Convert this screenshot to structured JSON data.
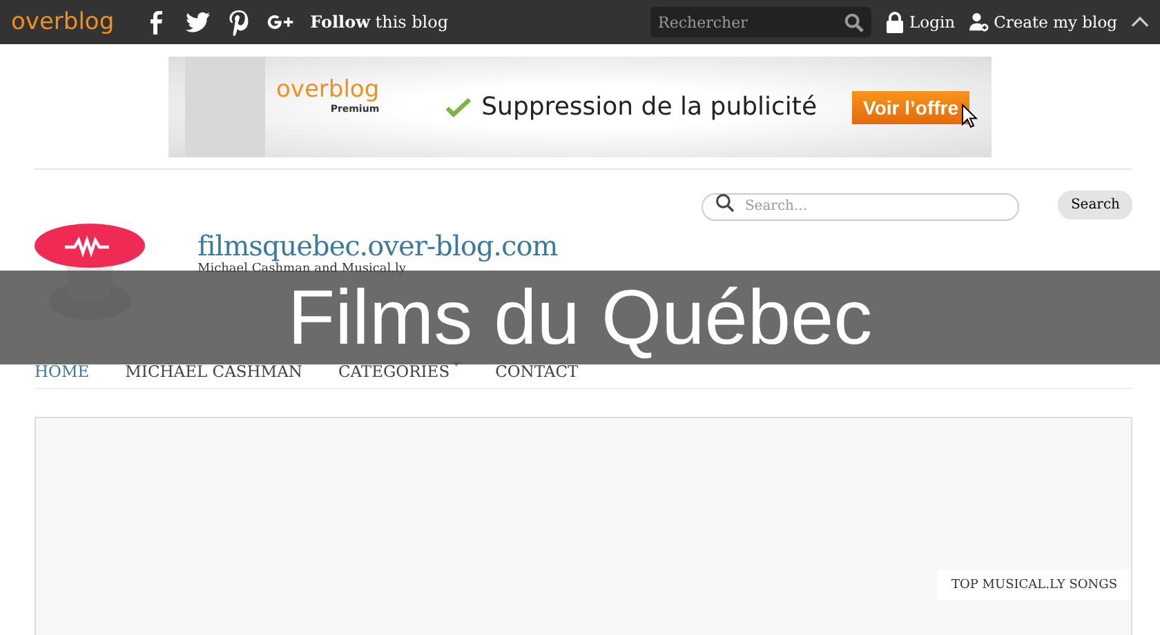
{
  "topbar": {
    "logo": "overblog",
    "follow_bold": "Follow",
    "follow_rest": "this blog",
    "search": {
      "placeholder": "Rechercher"
    },
    "login": "Login",
    "create": "Create my blog"
  },
  "ad": {
    "brand": "overblog",
    "brand_sub": "Premium",
    "message": "Suppression de la publicité",
    "button": "Voir l’offre"
  },
  "blog_search": {
    "placeholder": "Search...",
    "button": "Search"
  },
  "blog": {
    "title": "filmsquebec.over-blog.com",
    "subtitle": "Michael Cashman and Musical.ly"
  },
  "nav": [
    {
      "label": "HOME",
      "selected": true,
      "dropdown": false
    },
    {
      "label": "MICHAEL CASHMAN",
      "selected": false,
      "dropdown": false
    },
    {
      "label": "CATEGORIES",
      "selected": false,
      "dropdown": true
    },
    {
      "label": "CONTACT",
      "selected": false,
      "dropdown": false
    }
  ],
  "content": {
    "tag": "TOP MUSICAL.LY SONGS"
  },
  "overlay": {
    "title": "Films du Québec"
  }
}
